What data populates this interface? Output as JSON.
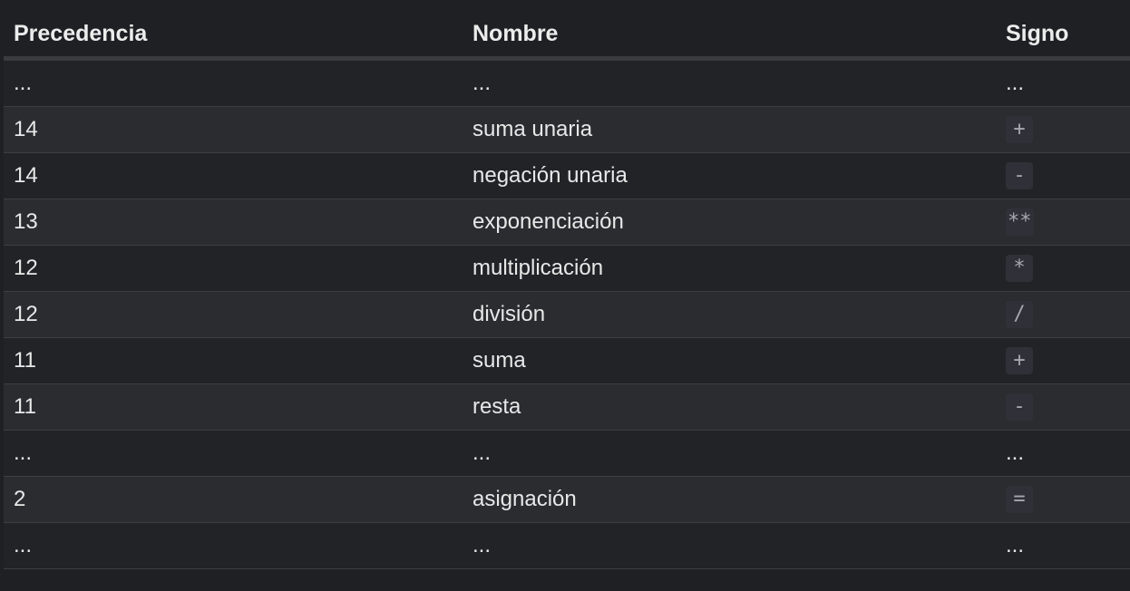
{
  "headers": {
    "precedence": "Precedencia",
    "name": "Nombre",
    "sign": "Signo"
  },
  "rows": [
    {
      "precedence": "...",
      "name": "...",
      "sign": "...",
      "is_code": false
    },
    {
      "precedence": "14",
      "name": "suma unaria",
      "sign": "+",
      "is_code": true
    },
    {
      "precedence": "14",
      "name": "negación unaria",
      "sign": "-",
      "is_code": true
    },
    {
      "precedence": "13",
      "name": "exponenciación",
      "sign": "**",
      "is_code": true
    },
    {
      "precedence": "12",
      "name": "multiplicación",
      "sign": "*",
      "is_code": true
    },
    {
      "precedence": "12",
      "name": "división",
      "sign": "/",
      "is_code": true
    },
    {
      "precedence": "11",
      "name": "suma",
      "sign": "+",
      "is_code": true
    },
    {
      "precedence": "11",
      "name": "resta",
      "sign": "-",
      "is_code": true
    },
    {
      "precedence": "...",
      "name": "...",
      "sign": "...",
      "is_code": false
    },
    {
      "precedence": "2",
      "name": "asignación",
      "sign": "=",
      "is_code": true
    },
    {
      "precedence": "...",
      "name": "...",
      "sign": "...",
      "is_code": false
    }
  ]
}
